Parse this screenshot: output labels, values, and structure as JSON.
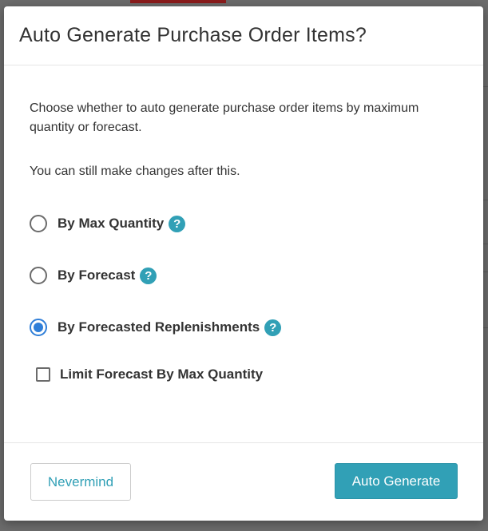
{
  "dialog": {
    "title": "Auto Generate Purchase Order Items?",
    "description": "Choose whether to auto generate purchase order items by maximum quantity or forecast.",
    "note": "You can still make changes after this.",
    "options": [
      {
        "label": "By Max Quantity",
        "checked": false,
        "help_icon": "question-circle-icon"
      },
      {
        "label": "By Forecast",
        "checked": false,
        "help_icon": "question-circle-icon"
      },
      {
        "label": "By Forecasted Replenishments",
        "checked": true,
        "help_icon": "question-circle-icon"
      }
    ],
    "limit_checkbox": {
      "label": "Limit Forecast By Max Quantity",
      "checked": false
    },
    "help_glyph": "?",
    "buttons": {
      "cancel_label": "Nevermind",
      "confirm_label": "Auto Generate"
    }
  },
  "colors": {
    "accent": "#31a0b6",
    "radio_selected": "#2f7ed8",
    "text": "#333333",
    "overlay": "#6b6b6b"
  }
}
